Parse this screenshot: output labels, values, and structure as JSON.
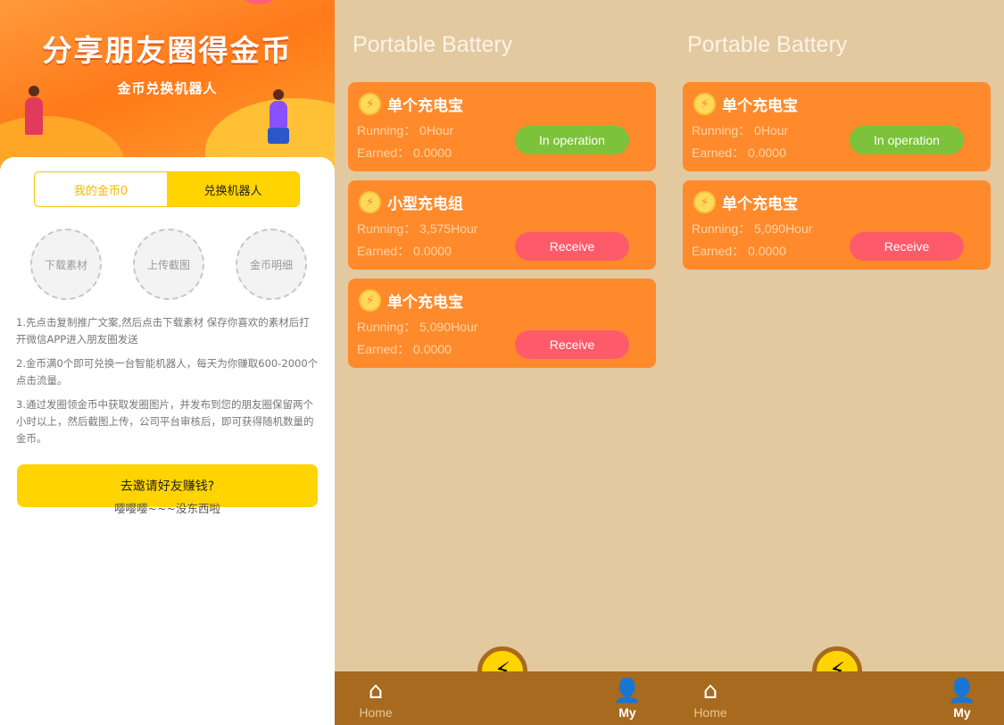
{
  "left": {
    "banner_title": "分享朋友圈得金币",
    "banner_subtitle": "金币兑换机器人",
    "segments": [
      "我的金币0",
      "兑换机器人"
    ],
    "actions": [
      "下载素材",
      "上传截图",
      "金币明细"
    ],
    "rules": [
      "1.先点击复制推广文案,然后点击下载素材 保存你喜欢的素材后打开微信APP进入朋友圈发送",
      "2.金币满0个即可兑换一台智能机器人，每天为你赚取600-2000个点击流量。",
      "3.通过发圈领金币中获取发圈图片，并发布到您的朋友圈保留两个小时以上，然后截图上传，公司平台审核后，即可获得随机数量的金币。"
    ],
    "invite_button": "去邀请好友赚钱?",
    "empty_message": "嘤嘤嘤~~~没东西啦"
  },
  "phone1": {
    "title": "Portable Battery",
    "tasks": [
      {
        "name": "单个充电宝",
        "running": "Running： 0Hour",
        "earned": "Earned： 0.0000",
        "button": "In operation"
      },
      {
        "name": "小型充电组",
        "running": "Running： 3,575Hour",
        "earned": "Earned： 0.0000",
        "button": "Receive"
      },
      {
        "name": "单个充电宝",
        "running": "Running： 5,090Hour",
        "earned": "Earned： 0.0000",
        "button": "Receive"
      }
    ],
    "tabs": {
      "home": "Home",
      "my": "My"
    }
  },
  "phone2": {
    "title": "Portable Battery",
    "tasks": [
      {
        "name": "单个充电宝",
        "running": "Running： 0Hour",
        "earned": "Earned： 0.0000",
        "button": "In operation"
      },
      {
        "name": "单个充电宝",
        "running": "Running： 5,090Hour",
        "earned": "Earned： 0.0000",
        "button": "Receive"
      }
    ],
    "tabs": {
      "home": "Home",
      "my": "My"
    }
  },
  "icons": {
    "bolt": "lightning-bolt-icon",
    "home": "home-icon",
    "my": "user-icon"
  },
  "colors": {
    "accent_yellow": "#ffd400",
    "task_orange": "#ff8a2c",
    "operation_green": "#7cc23a",
    "receive_red": "#ff5a6a",
    "tabbar_brown": "#a86a1e"
  }
}
